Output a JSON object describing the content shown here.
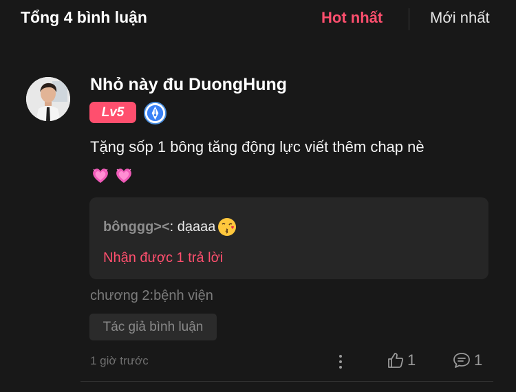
{
  "header": {
    "total_comments": "Tổng 4 bình luận",
    "sort_hot": "Hot nhất",
    "sort_new": "Mới nhất"
  },
  "comment": {
    "username": "Nhỏ này đu DuongHung",
    "level": "Lv5",
    "text": "Tặng sốp 1 bông tăng động lực viết thêm chap nè",
    "reply": {
      "author": "bônggg><",
      "separator": ": ",
      "text": "dạaaa",
      "count_label": "Nhận được 1 trả lời"
    },
    "chapter": "chương 2:bệnh viện",
    "author_tag": "Tác giả bình luận",
    "timestamp": "1 giờ trước",
    "likes": "1",
    "replies": "1"
  },
  "colors": {
    "accent": "#ff4f6e",
    "background": "#181818",
    "reply_box": "#262626"
  },
  "icons": [
    "avatar",
    "author-badge-icon",
    "heart-icon",
    "kiss-emoji-icon",
    "more-icon",
    "thumbs-up-icon",
    "comment-icon"
  ]
}
